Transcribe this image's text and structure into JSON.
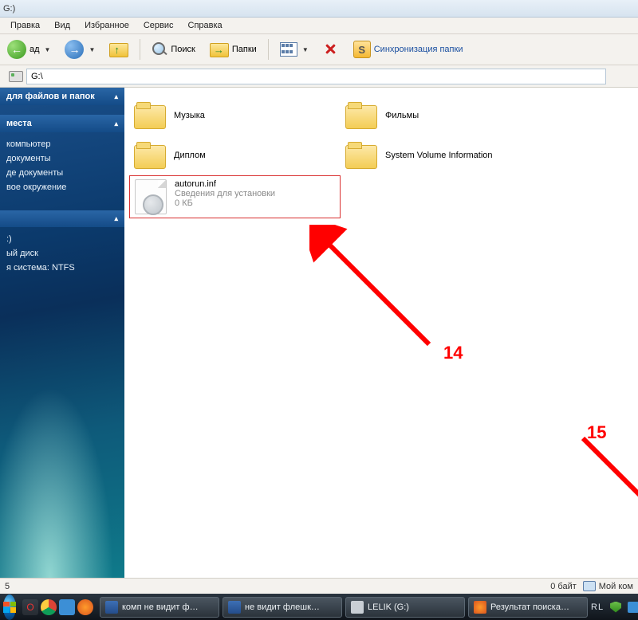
{
  "window": {
    "title": "G:)"
  },
  "menu": {
    "items": [
      "Правка",
      "Вид",
      "Избранное",
      "Сервис",
      "Справка"
    ]
  },
  "toolbar": {
    "back": "ад",
    "search": "Поиск",
    "folders": "Папки",
    "sync": "Синхронизация папки"
  },
  "address": {
    "label": "",
    "value": "G:\\"
  },
  "sidebar": {
    "tasks_header": "для файлов и папок",
    "places_header": "места",
    "places": [
      "компьютер",
      "документы",
      "де документы",
      "вое окружение"
    ],
    "details_header": "",
    "details": [
      ":)",
      "ый диск",
      "я система: NTFS"
    ]
  },
  "files": {
    "folders": [
      {
        "name": "Музыка"
      },
      {
        "name": "Фильмы"
      },
      {
        "name": "Диплом"
      },
      {
        "name": "System Volume Information"
      }
    ],
    "highlighted": {
      "name": "autorun.inf",
      "desc": "Сведения для установки",
      "size": "0 КБ"
    }
  },
  "annotations": {
    "a14": "14",
    "a15": "15"
  },
  "statusbar": {
    "left": "5",
    "bytes": "0 байт",
    "location": "Мой ком"
  },
  "taskbar": {
    "buttons": [
      {
        "icon": "word",
        "label": "комп не видит ф…"
      },
      {
        "icon": "word",
        "label": "не видит флешк…"
      },
      {
        "icon": "drv",
        "label": "LELIK (G:)"
      },
      {
        "icon": "ff",
        "label": "Результат поиска…"
      }
    ],
    "lang": "RL"
  }
}
